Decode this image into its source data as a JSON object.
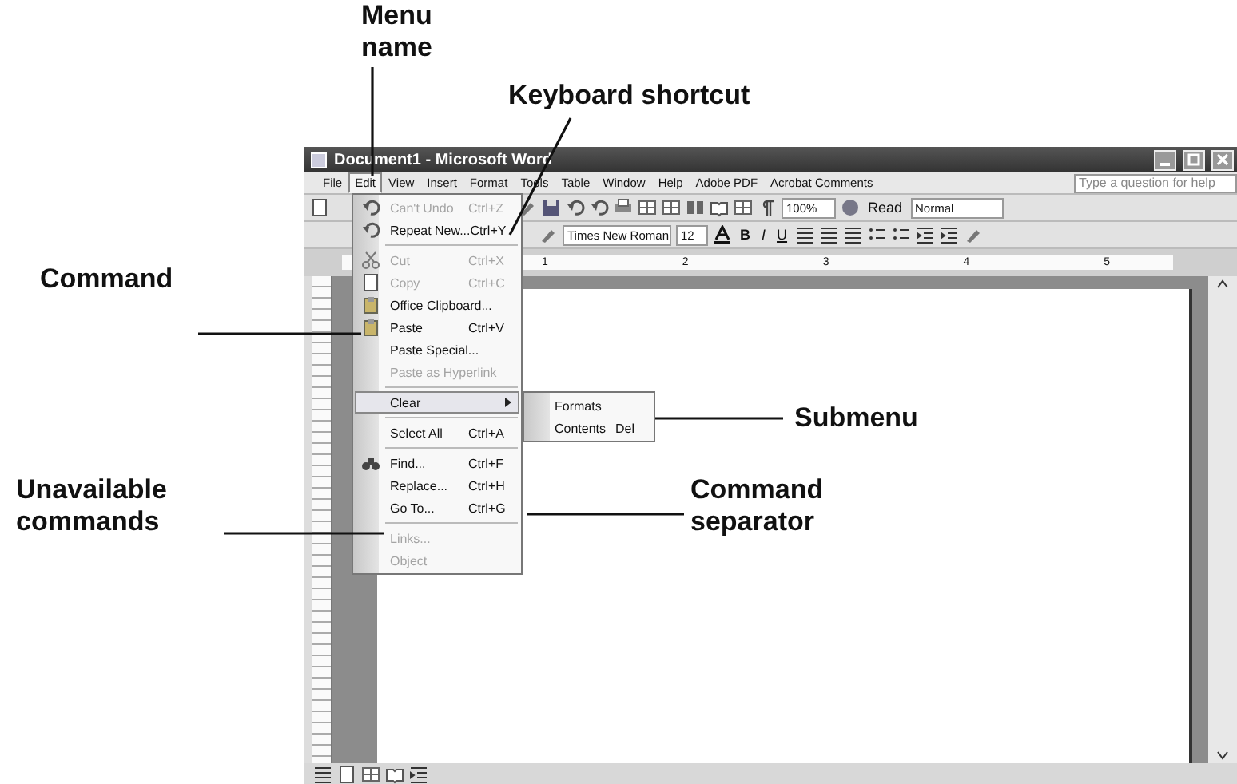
{
  "window": {
    "title": "Document1 - Microsoft Word"
  },
  "menu_bar": [
    {
      "label": "File",
      "selected": false
    },
    {
      "label": "Edit",
      "selected": true
    },
    {
      "label": "View",
      "selected": false
    },
    {
      "label": "Insert",
      "selected": false
    },
    {
      "label": "Format",
      "selected": false
    },
    {
      "label": "Tools",
      "selected": false
    },
    {
      "label": "Table",
      "selected": false
    },
    {
      "label": "Window",
      "selected": false
    },
    {
      "label": "Help",
      "selected": false
    },
    {
      "label": "Adobe PDF",
      "selected": false
    },
    {
      "label": "Acrobat Comments",
      "selected": false
    }
  ],
  "help_box": {
    "placeholder": "Type a question for help"
  },
  "standard_toolbar": {
    "zoom": "100%",
    "read": "Read",
    "style": "Normal"
  },
  "formatting_toolbar": {
    "font": "Times New Roman",
    "size": "12",
    "bold": "B",
    "italic": "I",
    "underline": "U"
  },
  "ruler": [
    "1",
    "2",
    "3",
    "4",
    "5"
  ],
  "edit_menu": [
    {
      "kind": "icon-item",
      "label": "Can't Undo",
      "shortcut": "Ctrl+Z",
      "disabled": true,
      "selected": false
    },
    {
      "kind": "icon-item",
      "label": "Repeat New...",
      "shortcut": "Ctrl+Y",
      "disabled": false,
      "selected": false
    },
    {
      "kind": "separator"
    },
    {
      "kind": "icon-item",
      "label": "Cut",
      "shortcut": "Ctrl+X",
      "disabled": true,
      "selected": false
    },
    {
      "kind": "icon-item",
      "label": "Copy",
      "shortcut": "Ctrl+C",
      "disabled": true,
      "selected": false
    },
    {
      "kind": "icon-item",
      "label": "Office Clipboard...",
      "disabled": false,
      "selected": false
    },
    {
      "kind": "icon-item",
      "label": "Paste",
      "shortcut": "Ctrl+V",
      "disabled": false,
      "selected": false
    },
    {
      "kind": "item",
      "label": "Paste Special...",
      "disabled": false,
      "selected": false
    },
    {
      "kind": "item",
      "label": "Paste as Hyperlink",
      "disabled": true,
      "selected": false
    },
    {
      "kind": "separator"
    },
    {
      "kind": "submenu",
      "label": "Clear",
      "disabled": false,
      "selected": true
    },
    {
      "kind": "separator"
    },
    {
      "kind": "item",
      "label": "Select All",
      "shortcut": "Ctrl+A",
      "disabled": false,
      "selected": false
    },
    {
      "kind": "separator"
    },
    {
      "kind": "icon-item",
      "label": "Find...",
      "shortcut": "Ctrl+F",
      "disabled": false,
      "selected": false
    },
    {
      "kind": "item",
      "label": "Replace...",
      "shortcut": "Ctrl+H",
      "disabled": false,
      "selected": false
    },
    {
      "kind": "item",
      "label": "Go To...",
      "shortcut": "Ctrl+G",
      "disabled": false,
      "selected": false
    },
    {
      "kind": "separator"
    },
    {
      "kind": "item",
      "label": "Links...",
      "disabled": true,
      "selected": false
    },
    {
      "kind": "item",
      "label": "Object",
      "disabled": true,
      "selected": false
    }
  ],
  "submenu": [
    {
      "label": "Formats",
      "selected": false
    },
    {
      "label": "Contents",
      "shortcut": "Del",
      "selected": false
    }
  ],
  "callouts": [
    {
      "text": "Menu name"
    },
    {
      "text": "Keyboard shortcut"
    },
    {
      "text": "Command"
    },
    {
      "text": "Submenu"
    },
    {
      "text": "Unavailable commands"
    },
    {
      "text": "Command separator"
    }
  ]
}
